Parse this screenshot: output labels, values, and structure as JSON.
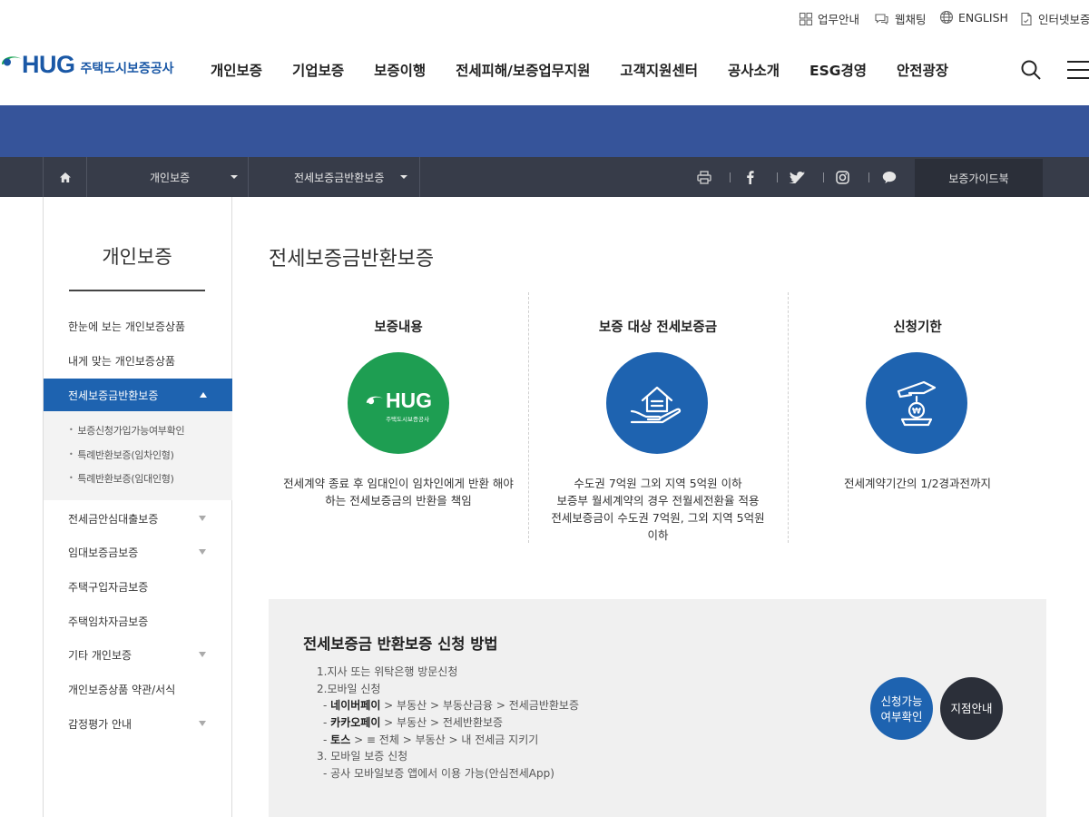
{
  "util_bar": {
    "items": [
      {
        "label": "업무안내",
        "icon": "grid-icon"
      },
      {
        "label": "웹채팅",
        "icon": "chat-icon"
      },
      {
        "label": "ENGLISH",
        "icon": "globe-icon"
      },
      {
        "label": "인터넷보증",
        "icon": "document-icon"
      }
    ]
  },
  "header": {
    "logo_mark": "HUG",
    "logo_text": "주택도시보증공사",
    "nav": [
      "개인보증",
      "기업보증",
      "보증이행",
      "전세피해/보증업무지원",
      "고객지원센터",
      "공사소개",
      "ESG경영",
      "안전광장"
    ]
  },
  "location": {
    "level1": "개인보증",
    "level2": "전세보증금반환보증",
    "guide_button": "보증가이드북"
  },
  "sidebar": {
    "title": "개인보증",
    "items": [
      {
        "label": "한눈에 보는 개인보증상품",
        "has_sub": false
      },
      {
        "label": "내게 맞는 개인보증상품",
        "has_sub": false
      },
      {
        "label": "전세보증금반환보증",
        "has_sub": true,
        "active": true
      },
      {
        "label": "전세금안심대출보증",
        "has_sub": true
      },
      {
        "label": "임대보증금보증",
        "has_sub": true
      },
      {
        "label": "주택구입자금보증",
        "has_sub": false
      },
      {
        "label": "주택임차자금보증",
        "has_sub": false
      },
      {
        "label": "기타 개인보증",
        "has_sub": true
      },
      {
        "label": "개인보증상품 약관/서식",
        "has_sub": false
      },
      {
        "label": "감정평가 안내",
        "has_sub": true
      }
    ],
    "sub_items": [
      "보증신청가입가능여부확인",
      "특례반환보증(임차인형)",
      "특례반환보증(임대인형)"
    ]
  },
  "main": {
    "title": "전세보증금반환보증",
    "columns": [
      {
        "heading": "보증내용",
        "circle_color": "#1e9e52",
        "icon": "hug-logo-icon",
        "circle_logo": "HUG",
        "circle_sub": "주택도시보증공사",
        "desc": "전세계약 종료 후 임대인이 임차인에게 반환 해야\n하는 전세보증금의 반환을 책임"
      },
      {
        "heading": "보증 대상 전세보증금",
        "circle_color": "#1e63b0",
        "icon": "house-hand-icon",
        "desc": "수도권 7억원 그외 지역 5억원 이하\n보증부 월세계약의 경우 전월세전환율 적용\n전세보증금이 수도권 7억원, 그외 지역 5억원\n이하"
      },
      {
        "heading": "신청기한",
        "circle_color": "#1e63b0",
        "icon": "coin-hand-icon",
        "desc": "전세계약기간의 1/2경과전까지"
      }
    ],
    "howto": {
      "title": "전세보증금 반환보증 신청 방법",
      "line1": "1.지사 또는 위탁은행 방문신청",
      "line2": "2.모바일 신청",
      "line3_bold": "네이버페이",
      "line3_rest": " > 부동산 > 부동산금융 > 전세금반환보증",
      "line4_bold": "카카오페이",
      "line4_rest": " > 부동산 > 전세반환보증",
      "line5_bold": "토스",
      "line5_rest": " > ≡ 전체 > 부동산 > 내 전세금 지키기",
      "line6": "3. 모바일 보증 신청",
      "line7": "- 공사 모바일보증 앱에서 이용 가능(안심전세App)",
      "btn_check": "신청가능\n여부확인",
      "btn_branch": "지점안내"
    }
  },
  "colors": {
    "brand_blue": "#1e63b0",
    "banner": "#36549a",
    "location_bar": "#373c49",
    "green": "#1e9e52",
    "dark_button": "#2b2f39"
  }
}
